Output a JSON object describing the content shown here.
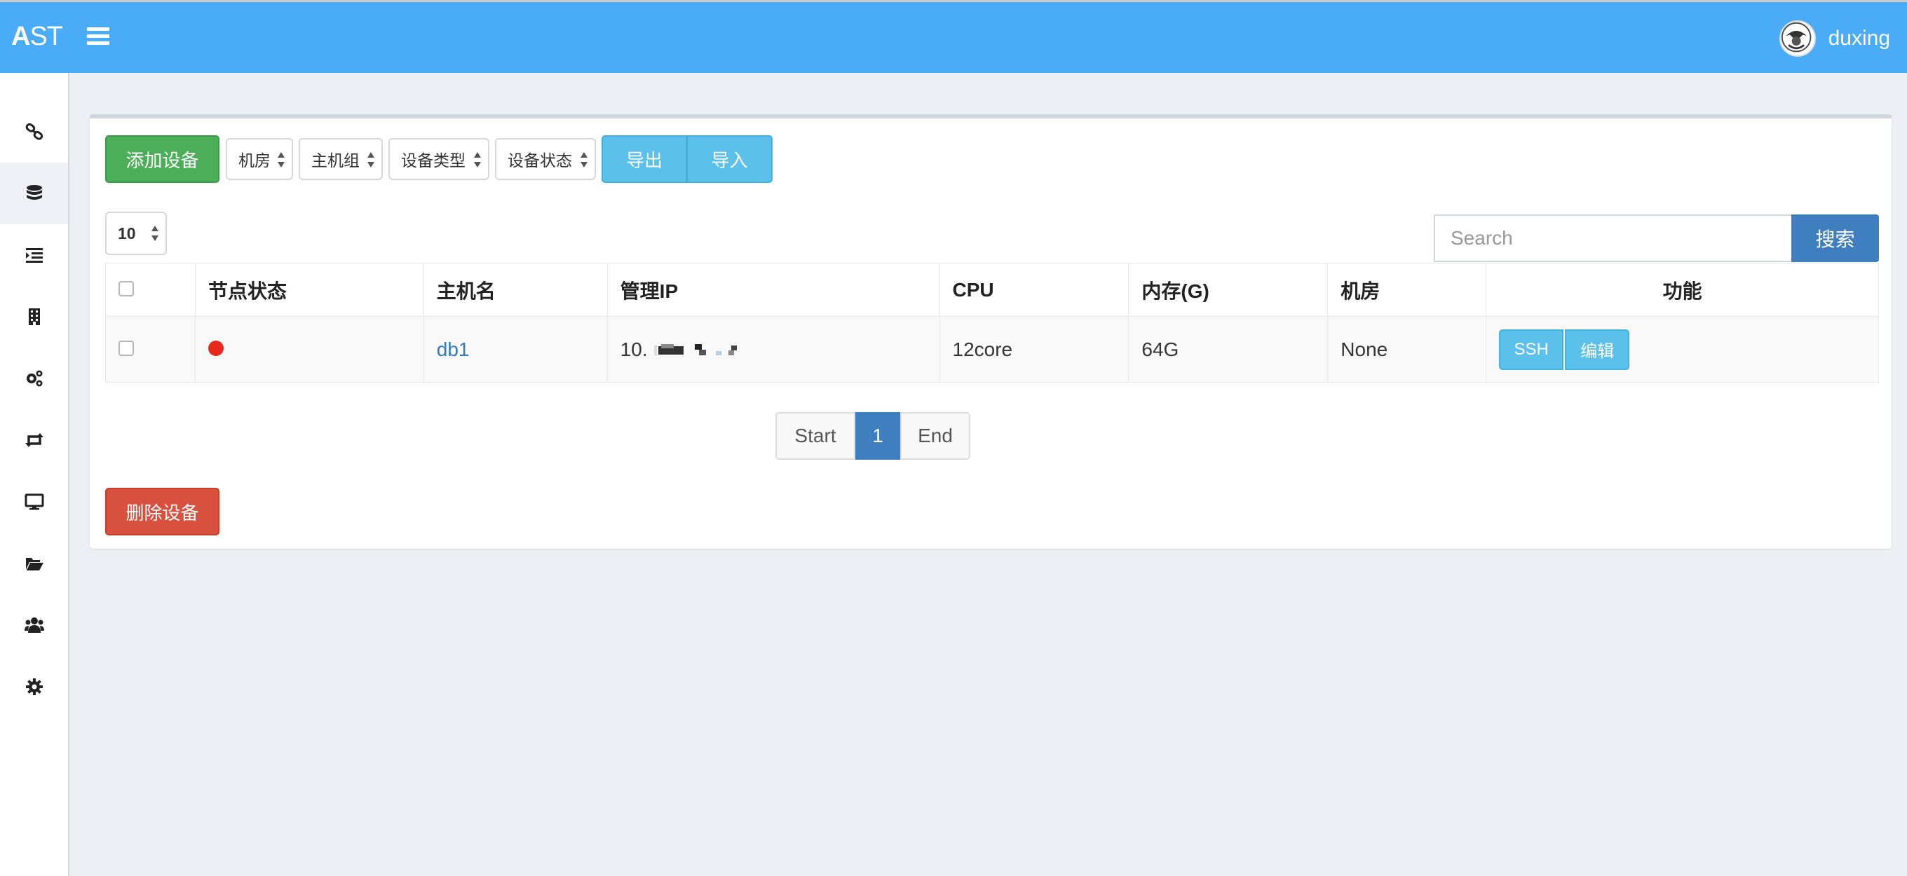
{
  "header": {
    "logo_bold": "A",
    "logo_rest": "ST",
    "username": "duxing"
  },
  "sidebar": {
    "items": [
      {
        "icon": "link-icon"
      },
      {
        "icon": "database-icon",
        "active": true
      },
      {
        "icon": "list-indent-icon"
      },
      {
        "icon": "building-icon"
      },
      {
        "icon": "cogs-icon"
      },
      {
        "icon": "retweet-icon"
      },
      {
        "icon": "desktop-icon"
      },
      {
        "icon": "folder-open-icon"
      },
      {
        "icon": "users-icon"
      },
      {
        "icon": "gear-icon"
      }
    ]
  },
  "toolbar": {
    "add_label": "添加设备",
    "filters": [
      "机房",
      "主机组",
      "设备类型",
      "设备状态"
    ],
    "export_label": "导出",
    "import_label": "导入",
    "page_size": "10",
    "search_placeholder": "Search",
    "search_label": "搜索",
    "delete_label": "删除设备"
  },
  "table": {
    "headers": [
      "节点状态",
      "主机名",
      "管理IP",
      "CPU",
      "内存(G)",
      "机房",
      "功能"
    ],
    "rows": [
      {
        "status_color": "#e8291e",
        "hostname": "db1",
        "ip_prefix": "10.",
        "cpu": "12core",
        "memory": "64G",
        "room": "None",
        "actions": [
          "SSH",
          "编辑"
        ]
      }
    ]
  },
  "pagination": {
    "start": "Start",
    "current": "1",
    "end": "End"
  },
  "colors": {
    "header": "#4aabf7",
    "add_button": "#4cae58",
    "delete_button": "#d8513e",
    "info_button": "#5bc0ea",
    "primary": "#3f7fbf"
  }
}
